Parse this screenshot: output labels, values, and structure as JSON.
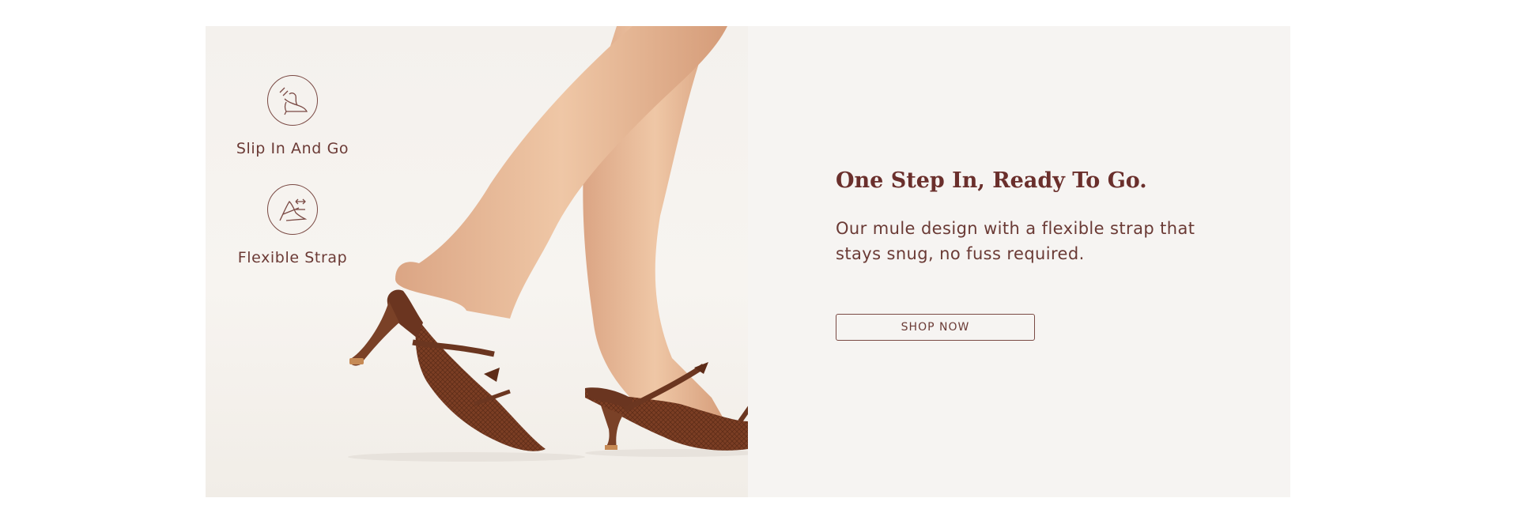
{
  "features": [
    {
      "icon": "slip-in-heel-icon",
      "label": "Slip In And Go"
    },
    {
      "icon": "flexible-strap-icon",
      "label": "Flexible Strap"
    }
  ],
  "promo": {
    "headline": "One Step In, Ready To Go.",
    "body": "Our mule design with a flexible strap that stays snug, no fuss required.",
    "cta_label": "SHOP NOW"
  },
  "colors": {
    "accent": "#6a2f2c",
    "shoe": "#7a3f26",
    "skin": "#e6b996"
  }
}
